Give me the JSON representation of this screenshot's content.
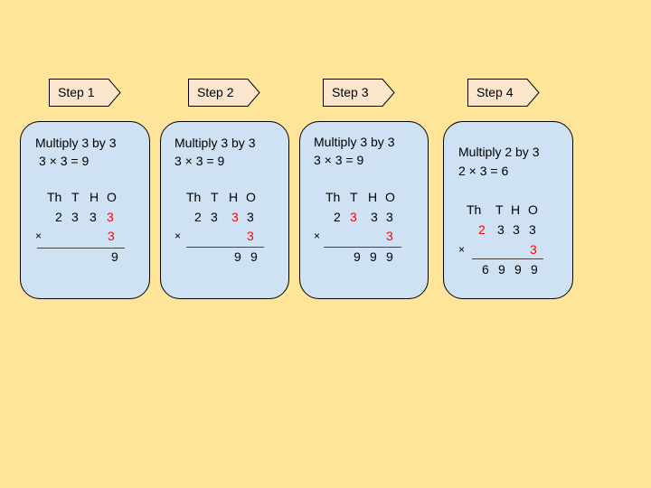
{
  "colors": {
    "background": "#ffe599",
    "card": "#cfe2f3",
    "tag": "#fce5cd",
    "highlight": "#ff0000"
  },
  "place_headers": [
    "Th",
    "T",
    "H",
    "O"
  ],
  "multiply_sign": "×",
  "steps": [
    {
      "label": "Step 1",
      "instruction": "Multiply 3 by 3",
      "equation": "3 × 3 = 9",
      "top_digits": [
        "2",
        "3",
        "3",
        "3"
      ],
      "highlight_index": 3,
      "multiplier": "3",
      "result": [
        "9"
      ]
    },
    {
      "label": "Step 2",
      "instruction": "Multiply 3 by 3",
      "equation": "3 × 3 = 9",
      "top_digits": [
        "2",
        "3",
        "3",
        "3"
      ],
      "highlight_index": 2,
      "multiplier": "3",
      "result": [
        "9",
        "9"
      ]
    },
    {
      "label": "Step 3",
      "instruction": "Multiply 3 by 3",
      "equation": "3 × 3 = 9",
      "top_digits": [
        "2",
        "3",
        "3",
        "3"
      ],
      "highlight_index": 1,
      "multiplier": "3",
      "result": [
        "9",
        "9",
        "9"
      ]
    },
    {
      "label": "Step 4",
      "instruction": "Multiply 2 by 3",
      "equation": "2 × 3 = 6",
      "top_digits": [
        "2",
        "3",
        "3",
        "3"
      ],
      "highlight_index": 0,
      "multiplier": "3",
      "result": [
        "6",
        "9",
        "9",
        "9"
      ]
    }
  ]
}
